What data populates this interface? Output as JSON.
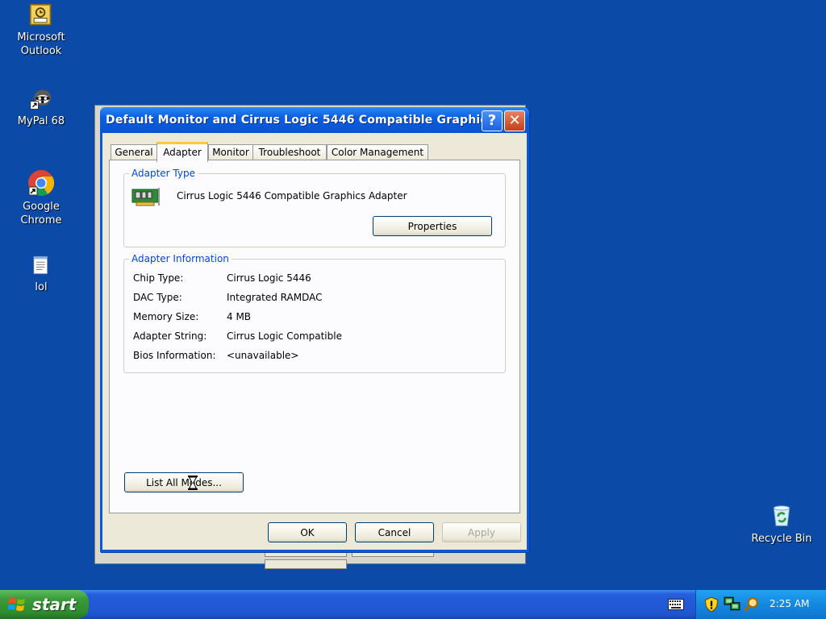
{
  "desktop": {
    "icons": [
      {
        "label_line1": "Microsoft",
        "label_line2": "Outlook",
        "icon": "outlook-icon"
      },
      {
        "label_line1": "MyPal 68",
        "label_line2": "",
        "icon": "mypal-icon"
      },
      {
        "label_line1": "Google Chrome",
        "label_line2": "",
        "icon": "chrome-icon"
      },
      {
        "label_line1": "lol",
        "label_line2": "",
        "icon": "notepad-icon"
      },
      {
        "label_line1": "Recycle Bin",
        "label_line2": "",
        "icon": "recycle-bin-icon"
      }
    ]
  },
  "dialog": {
    "title": "Default Monitor and Cirrus Logic 5446 Compatible Graphic...",
    "help_glyph": "?",
    "close_glyph": "✕",
    "tabs": [
      {
        "label": "General"
      },
      {
        "label": "Adapter",
        "active": true
      },
      {
        "label": "Monitor"
      },
      {
        "label": "Troubleshoot"
      },
      {
        "label": "Color Management"
      }
    ],
    "adapter_type": {
      "legend": "Adapter Type",
      "name": "Cirrus Logic 5446 Compatible Graphics Adapter",
      "properties_button": "Properties"
    },
    "adapter_info": {
      "legend": "Adapter Information",
      "rows": [
        {
          "label": "Chip Type:",
          "value": "Cirrus Logic 5446"
        },
        {
          "label": "DAC Type:",
          "value": "Integrated RAMDAC"
        },
        {
          "label": "Memory Size:",
          "value": "4 MB"
        },
        {
          "label": "Adapter String:",
          "value": "Cirrus Logic Compatible"
        },
        {
          "label": "Bios Information:",
          "value": "<unavailable>"
        }
      ]
    },
    "list_modes_button": "List All Modes...",
    "ok_button": "OK",
    "cancel_button": "Cancel",
    "apply_button": "Apply"
  },
  "taskbar": {
    "start_label": "start",
    "clock": "2:25 AM"
  },
  "colors": {
    "desktop": "#0b4aa6",
    "titlebar": "#0a5fe0",
    "legend_text": "#0046d5",
    "tab_highlight": "#ffc83c",
    "start_green": "#3a9c3a"
  }
}
